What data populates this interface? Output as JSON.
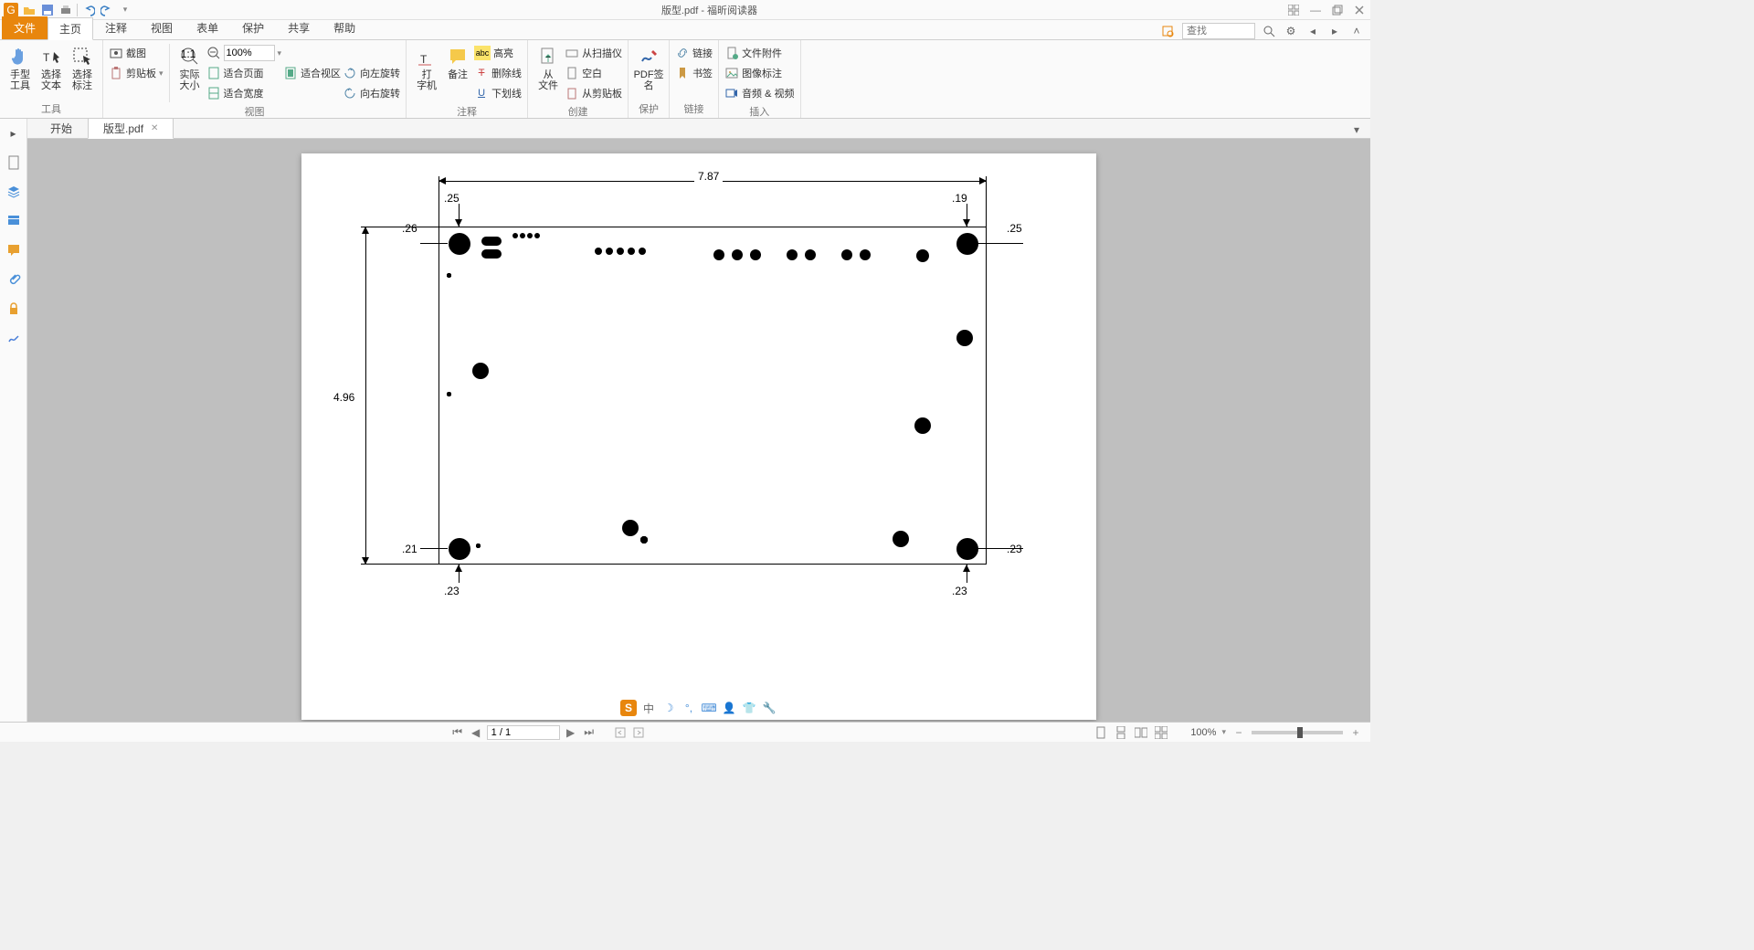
{
  "title": "版型.pdf - 福昕阅读器",
  "menu": {
    "file": "文件",
    "home": "主页",
    "comment": "注释",
    "view": "视图",
    "form": "表单",
    "protect": "保护",
    "share": "共享",
    "help": "帮助"
  },
  "search_placeholder": "查找",
  "ribbon": {
    "tools": {
      "hand": "手型\n工具",
      "select_text": "选择\n文本",
      "select_annot": "选择\n标注",
      "label": "工具"
    },
    "view": {
      "snapshot": "截图",
      "clipboard": "剪贴板",
      "actual": "实际\n大小",
      "fit_page": "适合页面",
      "fit_width": "适合宽度",
      "fit_visible": "适合视区",
      "rot_left": "向左旋转",
      "rot_right": "向右旋转",
      "zoom_value": "100%",
      "label": "视图"
    },
    "annot": {
      "typewriter": "打\n字机",
      "note": "备注",
      "highlight": "高亮",
      "strike": "删除线",
      "underline": "下划线",
      "label": "注释"
    },
    "create": {
      "from_file": "从\n文件",
      "from_scanner": "从扫描仪",
      "blank": "空白",
      "from_clip": "从剪贴板",
      "label": "创建"
    },
    "protect": {
      "sign": "PDF签\n名",
      "label": "保护"
    },
    "links": {
      "link": "链接",
      "bookmark": "书签",
      "label": "链接"
    },
    "insert": {
      "file_attach": "文件附件",
      "image_annot": "图像标注",
      "av": "音频 & 视频",
      "label": "插入"
    }
  },
  "doctabs": {
    "start": "开始",
    "file": "版型.pdf"
  },
  "statusbar": {
    "page": "1 / 1",
    "zoom": "100%"
  },
  "pcb": {
    "width": "7.87",
    "height": "4.96",
    "tl_x": ".25",
    "tl_y": ".26",
    "tr_x": ".19",
    "tr_y": ".25",
    "bl_x": ".23",
    "bl_y": ".21",
    "br_x": ".23",
    "br_y": ".23"
  }
}
